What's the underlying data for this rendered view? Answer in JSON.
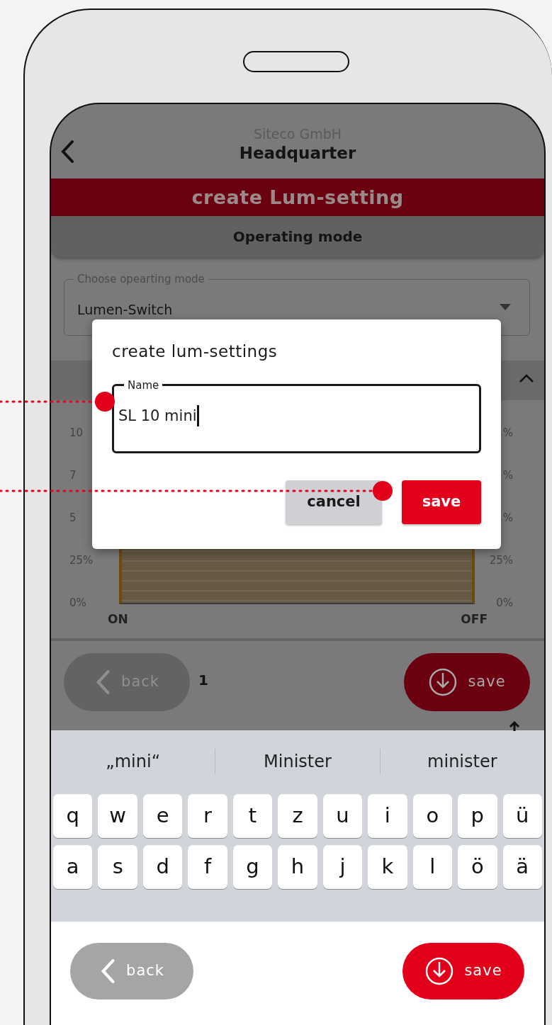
{
  "header": {
    "company": "Siteco GmbH",
    "site": "Headquarter"
  },
  "title_bar": "create Lum-setting",
  "section_title": "Operating mode",
  "mode_select": {
    "label": "Choose opearting mode",
    "value": "Lumen-Switch"
  },
  "chart": {
    "left_labels": [
      "10",
      "7",
      "5",
      "25%",
      "0%"
    ],
    "right_labels": [
      "%",
      "%",
      "%",
      "25%",
      "0%"
    ],
    "x_labels": [
      "ON",
      "OFF"
    ]
  },
  "group_label": "1",
  "background_buttons": [
    {
      "kind": "back",
      "label": "back"
    },
    {
      "kind": "save",
      "label": "save"
    }
  ],
  "dialog": {
    "title": "create lum-settings",
    "field": {
      "label": "Name",
      "value": "SL 10 mini"
    },
    "buttons": [
      {
        "kind": "secondary",
        "label": "cancel"
      },
      {
        "kind": "primary",
        "label": "save"
      }
    ]
  },
  "keyboard": {
    "suggestions": [
      "„mini“",
      "Minister",
      "minister"
    ],
    "rows": [
      [
        "q",
        "w",
        "e",
        "r",
        "t",
        "z",
        "u",
        "i",
        "o",
        "p",
        "ü"
      ],
      [
        "a",
        "s",
        "d",
        "f",
        "g",
        "h",
        "j",
        "k",
        "l",
        "ö",
        "ä"
      ]
    ]
  },
  "bottom_buttons": [
    {
      "kind": "back",
      "label": "back"
    },
    {
      "kind": "save",
      "label": "save"
    }
  ]
}
